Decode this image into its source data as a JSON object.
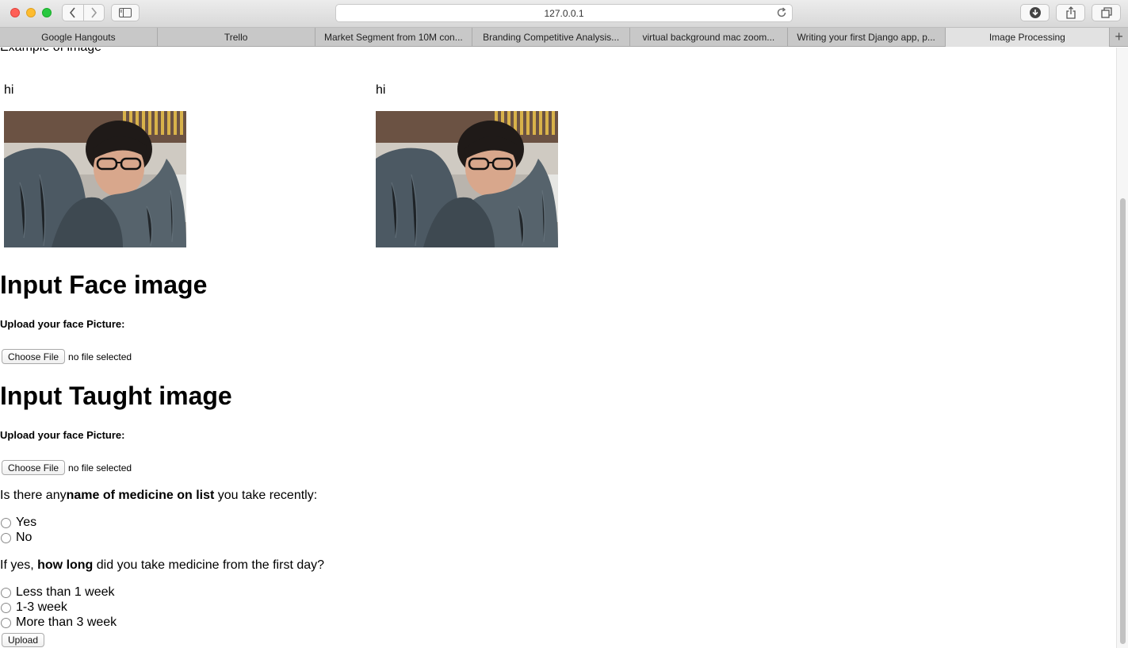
{
  "browser": {
    "url": "127.0.0.1",
    "tabs": [
      {
        "label": "Google Hangouts"
      },
      {
        "label": "Trello"
      },
      {
        "label": "Market Segment from 10M con..."
      },
      {
        "label": "Branding Competitive Analysis..."
      },
      {
        "label": "virtual background mac zoom..."
      },
      {
        "label": "Writing your first Django app, p..."
      },
      {
        "label": "Image Processing"
      }
    ],
    "active_tab": "Image Processing"
  },
  "page": {
    "example_title": "Example of image",
    "images": [
      {
        "label": "hi"
      },
      {
        "label": "hi"
      }
    ],
    "face_section": {
      "heading": "Input Face image",
      "upload_label": "Upload your face Picture:",
      "choose_file": "Choose File",
      "file_status": "no file selected"
    },
    "taught_section": {
      "heading": "Input Taught image",
      "upload_label": "Upload your face Picture:",
      "choose_file": "Choose File",
      "file_status": "no file selected"
    },
    "q1": {
      "prefix": "Is there any",
      "bold": "name of medicine on list",
      "suffix": " you take recently:",
      "options": [
        "Yes",
        "No"
      ]
    },
    "q2": {
      "prefix": "If yes, ",
      "bold": "how long",
      "suffix": " did you take medicine from the first day?",
      "options": [
        "Less than 1 week",
        "1-3 week",
        "More than 3 week"
      ]
    },
    "submit_label": "Upload"
  },
  "icons": {
    "back": "chevron-left-icon",
    "forward": "chevron-right-icon",
    "sidebar": "sidebar-icon",
    "reload": "reload-icon",
    "download": "download-icon",
    "share": "share-icon",
    "tabs": "tabs-overview-icon",
    "new_tab": "plus-icon"
  }
}
